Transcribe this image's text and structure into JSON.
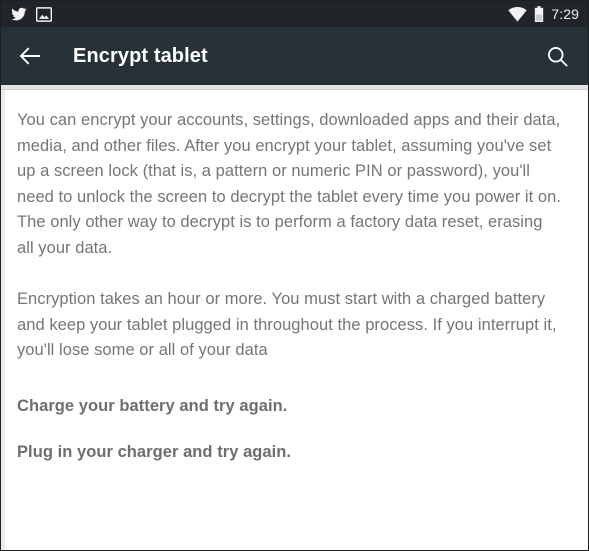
{
  "status_bar": {
    "left_icons": [
      {
        "name": "twitter-icon",
        "label": "Twitter notification"
      },
      {
        "name": "screenshot-image-icon",
        "label": "Screenshot captured"
      }
    ],
    "right_icons": [
      {
        "name": "wifi-icon",
        "label": "Wi-Fi connected"
      },
      {
        "name": "battery-icon",
        "label": "Battery half"
      }
    ],
    "time": "7:29",
    "background_color": "#212529",
    "icon_color": "#f2f2f2"
  },
  "app_bar": {
    "back_label": "Navigate up",
    "title": "Encrypt tablet",
    "search_label": "Search",
    "background_color": "#263238",
    "title_color": "#ffffff"
  },
  "content": {
    "paragraph_1": "You can encrypt your accounts, settings, downloaded apps and their data, media, and other files. After you encrypt your tablet, assuming you've set up a screen lock (that is, a pattern or numeric PIN or password), you'll need to unlock the screen to decrypt the tablet every time you power it on. The only other way to decrypt is to perform a factory data reset, erasing all your data.",
    "paragraph_2": "Encryption takes an hour or more. You must start with a charged battery and keep your tablet plugged in throughout the process. If you interrupt it, you'll lose some or all of your data",
    "warning_1": "Charge your battery and try again.",
    "warning_2": "Plug in your charger and try again.",
    "text_color": "#757575",
    "warning_color": "#6e6e6e",
    "background_color": "#ffffff"
  }
}
